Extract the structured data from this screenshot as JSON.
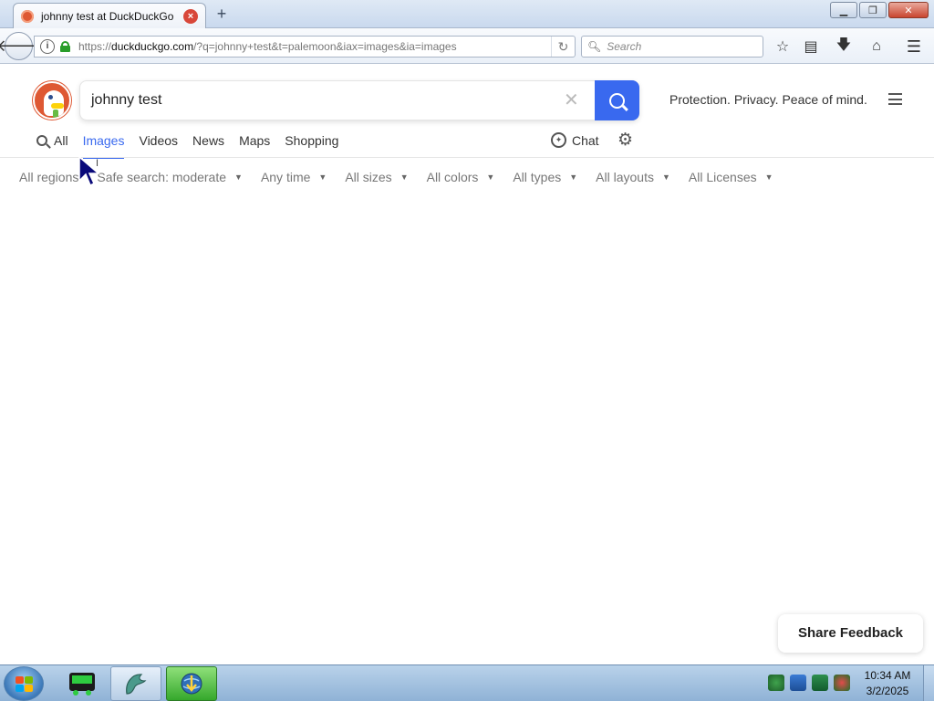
{
  "browser": {
    "tab_title": "johnny test at DuckDuckGo",
    "new_tab_label": "+",
    "url_prefix": "https://",
    "url_host": "duckduckgo.com",
    "url_path": "/?q=johnny+test&t=palemoon&iax=images&ia=images",
    "search_placeholder": "Search"
  },
  "ddg": {
    "query": "johnny test",
    "tagline": "Protection. Privacy. Peace of mind.",
    "verticals": [
      "All",
      "Images",
      "Videos",
      "News",
      "Maps",
      "Shopping"
    ],
    "active_vertical": "Images",
    "chat_label": "Chat",
    "filters": [
      "All regions",
      "Safe search: moderate",
      "Any time",
      "All sizes",
      "All colors",
      "All types",
      "All layouts",
      "All Licenses"
    ],
    "feedback_label": "Share Feedback",
    "accent_color": "#3969ef",
    "brand_color": "#de5833"
  },
  "taskbar": {
    "time": "10:34 AM",
    "date": "3/2/2025"
  }
}
